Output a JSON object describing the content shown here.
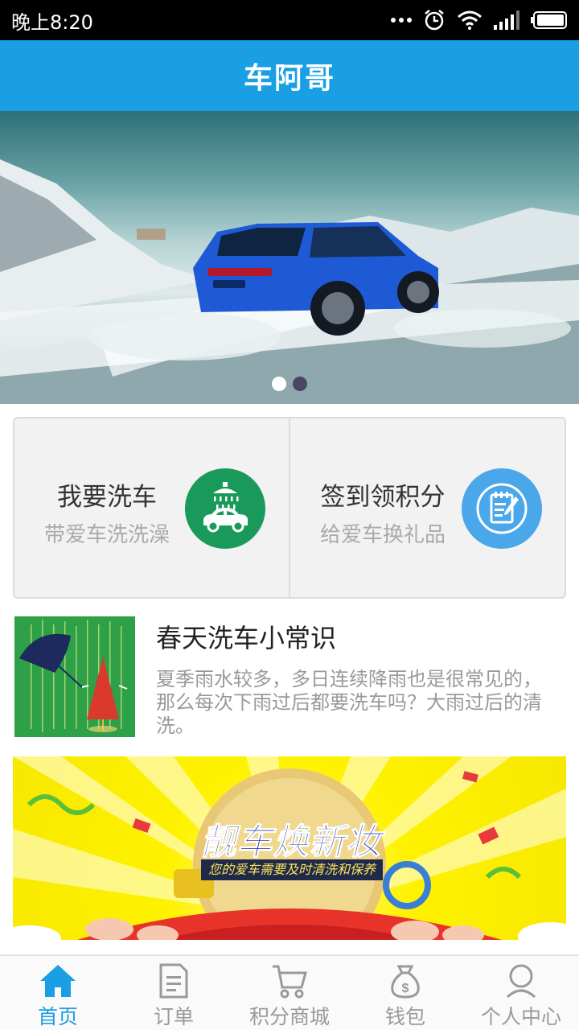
{
  "status_bar": {
    "time": "晚上8:20",
    "icons": [
      "more-dots-icon",
      "alarm-icon",
      "wifi-icon",
      "signal-icon",
      "battery-icon"
    ]
  },
  "app_bar": {
    "title": "车阿哥"
  },
  "banner": {
    "slide_count": 2,
    "active_index": 0
  },
  "cards": [
    {
      "title": "我要洗车",
      "subtitle": "带爱车洗洗澡",
      "icon": "car-wash-icon",
      "color": "#1a9a5a"
    },
    {
      "title": "签到领积分",
      "subtitle": "给爱车换礼品",
      "icon": "checkin-notepad-icon",
      "color": "#4aa7ea"
    }
  ],
  "article": {
    "title": "春天洗车小常识",
    "description": "夏季雨水较多，多日连续降雨也是很常见的，那么每次下雨过后都要洗车吗？大雨过后的清洗。"
  },
  "promo": {
    "title": "靓车焕新妆",
    "subtitle": "您的爱车需要及时清洗和保养"
  },
  "tabs": [
    {
      "label": "首页",
      "icon": "home-icon",
      "active": true
    },
    {
      "label": "订单",
      "icon": "order-document-icon",
      "active": false
    },
    {
      "label": "积分商城",
      "icon": "cart-icon",
      "active": false
    },
    {
      "label": "钱包",
      "icon": "money-bag-icon",
      "active": false
    },
    {
      "label": "个人中心",
      "icon": "person-icon",
      "active": false
    }
  ],
  "colors": {
    "primary": "#1a9fe4",
    "tab_inactive": "#9a9a9a"
  }
}
